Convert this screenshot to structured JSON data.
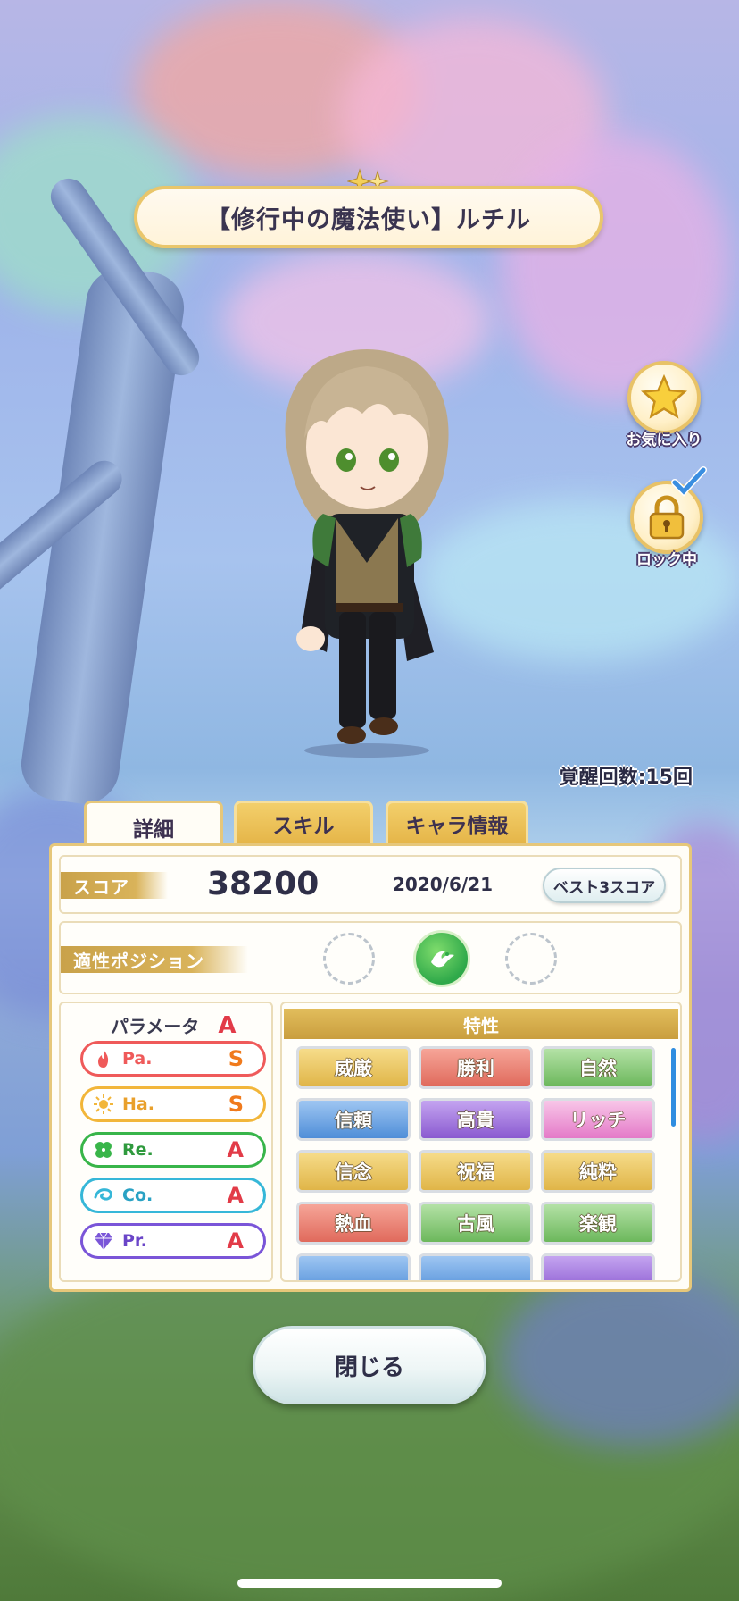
{
  "title": "【修行中の魔法使い】ルチル",
  "side_buttons": {
    "favorite_label": "お気に入り",
    "lock_label": "ロック中"
  },
  "awaken_text": "覚醒回数:15回",
  "tabs": [
    {
      "label": "詳細",
      "active": true
    },
    {
      "label": "スキル",
      "active": false
    },
    {
      "label": "キャラ情報",
      "active": false
    }
  ],
  "score": {
    "label": "スコア",
    "value": "38200",
    "date": "2020/6/21",
    "best3_label": "ベスト3スコア"
  },
  "position": {
    "label": "適性ポジション",
    "active_slot": 2
  },
  "parameters": {
    "title": "パラメータ",
    "overall_grade": "A",
    "items": [
      {
        "label": "Pa.",
        "grade": "S",
        "color": "#ef5a5a",
        "icon": "flame-icon"
      },
      {
        "label": "Ha.",
        "grade": "S",
        "color": "#f2b63a",
        "icon": "sun-icon"
      },
      {
        "label": "Re.",
        "grade": "A",
        "color": "#38b54a",
        "icon": "clover-icon"
      },
      {
        "label": "Co.",
        "grade": "A",
        "color": "#36b7d8",
        "icon": "swirl-icon"
      },
      {
        "label": "Pr.",
        "grade": "A",
        "color": "#7a55d8",
        "icon": "gem-icon"
      }
    ]
  },
  "traits": {
    "title": "特性",
    "items": [
      {
        "label": "威厳",
        "color": "#e8c25a"
      },
      {
        "label": "勝利",
        "color": "#ee7a6a"
      },
      {
        "label": "自然",
        "color": "#7cc36e"
      },
      {
        "label": "信頼",
        "color": "#5c9de0"
      },
      {
        "label": "高貴",
        "color": "#9a6ad8"
      },
      {
        "label": "リッチ",
        "color": "#ee8ad0"
      },
      {
        "label": "信念",
        "color": "#e8c25a"
      },
      {
        "label": "祝福",
        "color": "#e8c25a"
      },
      {
        "label": "純粋",
        "color": "#e8c25a"
      },
      {
        "label": "熱血",
        "color": "#ee7a6a"
      },
      {
        "label": "古風",
        "color": "#7cc36e"
      },
      {
        "label": "楽観",
        "color": "#7cc36e"
      }
    ]
  },
  "close_label": "閉じる"
}
